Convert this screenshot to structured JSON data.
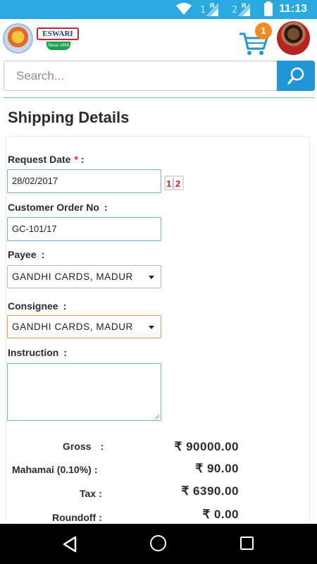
{
  "status_bar": {
    "time": "11:13",
    "sim1": "1",
    "sim2": "2",
    "roaming": "R"
  },
  "header": {
    "logo_text": "ESWARI",
    "logo_sub": "Since 1969",
    "cart_count": "1",
    "icons": [
      "goddess-logo",
      "eswari-logo",
      "cart-icon",
      "user-avatar"
    ]
  },
  "search": {
    "placeholder": "Search..."
  },
  "page": {
    "title": "Shipping Details"
  },
  "form": {
    "request_date": {
      "label": "Request Date",
      "required": "*",
      "value": "28/02/2017",
      "calendar_glyph": "1|2"
    },
    "customer_order_no": {
      "label": "Customer Order No",
      "value": "GC-101/17"
    },
    "payee": {
      "label": "Payee",
      "value": "GANDHI CARDS, MADUR"
    },
    "consignee": {
      "label": "Consignee",
      "value": "GANDHI CARDS, MADUR"
    },
    "instruction": {
      "label": "Instruction",
      "value": ""
    },
    "colon": ":"
  },
  "totals": [
    {
      "label": "Gross",
      "colon": ":",
      "value": "₹ 90000.00"
    },
    {
      "label": "Mahamai (0.10%)",
      "colon": ":",
      "value": "₹ 90.00"
    },
    {
      "label": "Tax",
      "colon": ":",
      "value": "₹ 6390.00"
    },
    {
      "label": "Roundoff",
      "colon": ":",
      "value": "₹ 0.00"
    }
  ],
  "colors": {
    "status_bar": "#29a9e0",
    "search_button": "#2196d6",
    "badge": "#f18a23",
    "required": "#e02323",
    "focus_border": "#e29a45"
  }
}
